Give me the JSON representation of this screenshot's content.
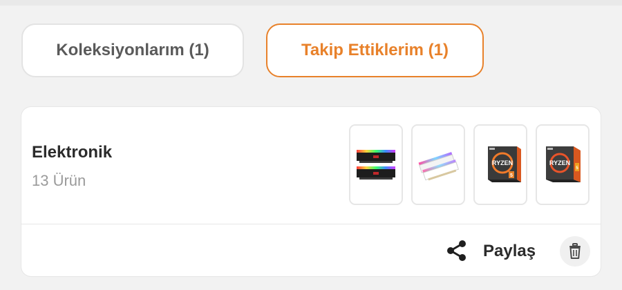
{
  "tabs": {
    "collections_label": "Koleksiyonlarım (1)",
    "following_label": "Takip Ettiklerim (1)"
  },
  "collection": {
    "title": "Elektronik",
    "count_label": "13 Ürün",
    "thumbnails": [
      "ram-rgb-black-image",
      "ram-rgb-white-image",
      "ryzen-box-image",
      "ryzen-box-image"
    ]
  },
  "actions": {
    "share_label": "Paylaş"
  },
  "colors": {
    "accent": "#e8812a",
    "background": "#f2f2f2",
    "card": "#ffffff",
    "text": "#2b2b2b",
    "muted": "#9a9a9a"
  }
}
